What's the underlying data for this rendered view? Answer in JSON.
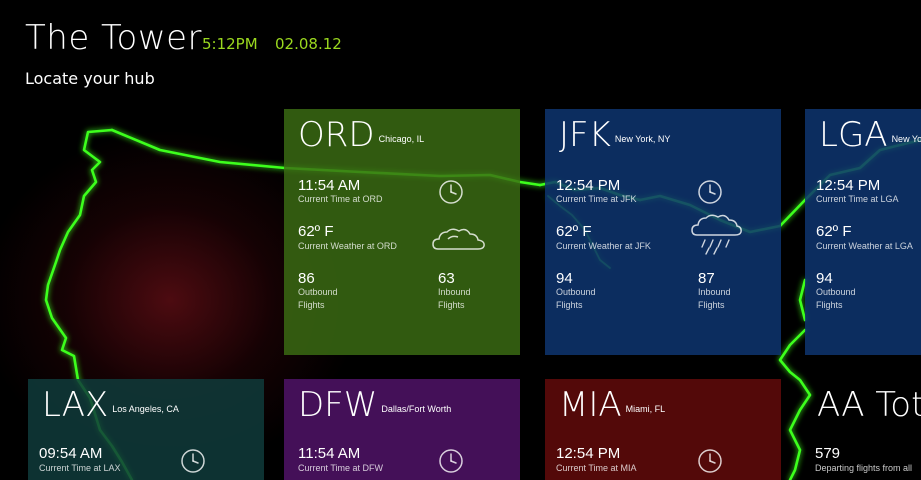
{
  "header": {
    "title": "The Tower",
    "time": "5:12PM",
    "date": "02.08.12",
    "subtitle": "Locate your hub"
  },
  "colors": {
    "accent_green": "#9bd91f",
    "map_glow": "#3cff1e",
    "ord": "#3c6e14",
    "jfk": "#0e3570",
    "lga": "#0e3570",
    "lax": "#0f3b3b",
    "dfw": "#4a1160",
    "mia": "#5a0a0a",
    "aa": "#000000"
  },
  "tiles": {
    "ord": {
      "code": "ORD",
      "city": "Chicago, IL",
      "time": "11:54 AM",
      "time_label": "Current Time at ORD",
      "weather": "62º F",
      "weather_label": "Current Weather at ORD",
      "weather_icon": "cloud-icon",
      "outbound": "86",
      "outbound_label1": "Outbound",
      "outbound_label2": "Flights",
      "inbound": "63",
      "inbound_label1": "Inbound",
      "inbound_label2": "Flights"
    },
    "jfk": {
      "code": "JFK",
      "city": "New York, NY",
      "time": "12:54 PM",
      "time_label": "Current Time at JFK",
      "weather": "62º F",
      "weather_label": "Current Weather at JFK",
      "weather_icon": "rain-cloud-icon",
      "outbound": "94",
      "outbound_label1": "Outbound",
      "outbound_label2": "Flights",
      "inbound": "87",
      "inbound_label1": "Inbound",
      "inbound_label2": "Flights"
    },
    "lga": {
      "code": "LGA",
      "city": "New York",
      "time": "12:54  PM",
      "time_label": "Current Time at LGA",
      "weather": "62º F",
      "weather_label": "Current Weather at LGA",
      "outbound": "94",
      "outbound_label1": "Outbound",
      "outbound_label2": "Flights"
    },
    "lax": {
      "code": "LAX",
      "city": "Los Angeles, CA",
      "time": "09:54 AM",
      "time_label": "Current Time at LAX"
    },
    "dfw": {
      "code": "DFW",
      "city": "Dallas/Fort Worth",
      "time": "11:54 AM",
      "time_label": "Current Time at DFW"
    },
    "mia": {
      "code": "MIA",
      "city": "Miami, FL",
      "time": "12:54  PM",
      "time_label": "Current Time at MIA"
    },
    "aa": {
      "code": "AA Tot",
      "count": "579",
      "count_label": "Departing flights from all"
    }
  }
}
